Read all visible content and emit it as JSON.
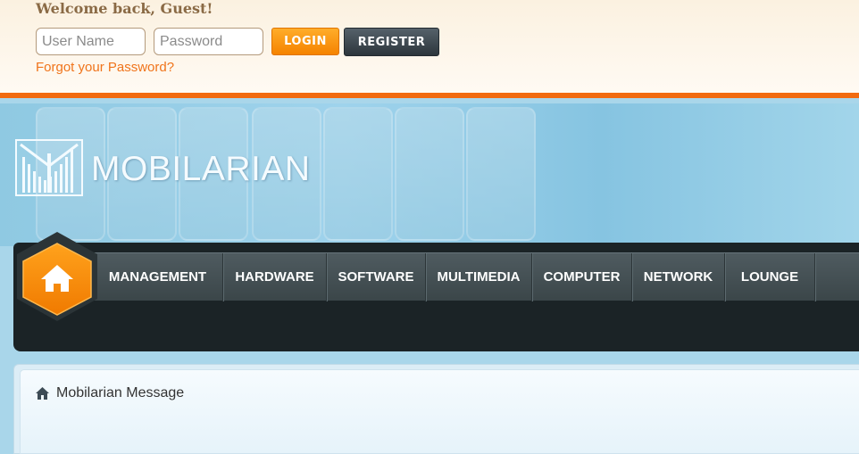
{
  "login": {
    "welcome": "Welcome back, Guest!",
    "username_placeholder": "User Name",
    "password_placeholder": "Password",
    "login_label": "LOGIN",
    "register_label": "REGISTER",
    "forgot_label": "Forgot your Password?"
  },
  "brand": {
    "name": "MOBILARIAN"
  },
  "nav": {
    "home_icon": "home-icon",
    "items": [
      {
        "label": "MANAGEMENT"
      },
      {
        "label": "HARDWARE"
      },
      {
        "label": "SOFTWARE"
      },
      {
        "label": "MULTIMEDIA"
      },
      {
        "label": "COMPUTER"
      },
      {
        "label": "NETWORK"
      },
      {
        "label": "LOUNGE"
      }
    ]
  },
  "breadcrumb": {
    "icon": "home-icon",
    "label": "Mobilarian Message"
  },
  "colors": {
    "accent": "#f26b0f",
    "nav_dark": "#1b2326",
    "link": "#f0741b"
  }
}
